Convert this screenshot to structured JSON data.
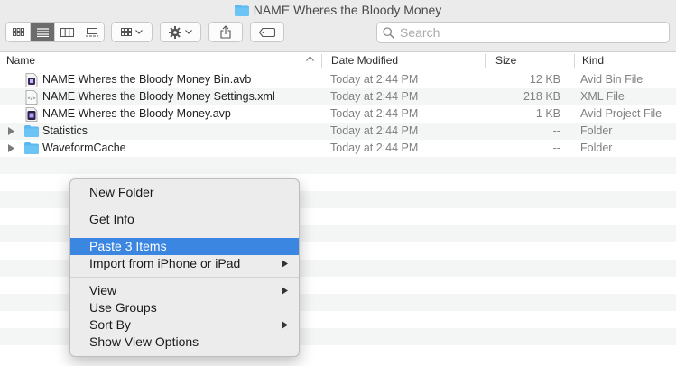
{
  "window": {
    "title": "NAME Wheres the Bloody Money"
  },
  "toolbar": {
    "view_modes": [
      {
        "name": "icon-view",
        "icon": "grid-icon",
        "active": false
      },
      {
        "name": "list-view",
        "icon": "list-icon",
        "active": true
      },
      {
        "name": "column-view",
        "icon": "columns-icon",
        "active": false
      },
      {
        "name": "gallery-view",
        "icon": "gallery-icon",
        "active": false
      }
    ],
    "search_placeholder": "Search"
  },
  "columns": {
    "name": "Name",
    "date": "Date Modified",
    "size": "Size",
    "kind": "Kind"
  },
  "files": [
    {
      "name": "NAME Wheres the Bloody Money Bin.avb",
      "date": "Today at 2:44 PM",
      "size": "12 KB",
      "kind": "Avid Bin File",
      "icon": "avid-bin-icon"
    },
    {
      "name": "NAME Wheres the Bloody Money Settings.xml",
      "date": "Today at 2:44 PM",
      "size": "218 KB",
      "kind": "XML File",
      "icon": "xml-file-icon"
    },
    {
      "name": "NAME Wheres the Bloody Money.avp",
      "date": "Today at 2:44 PM",
      "size": "1 KB",
      "kind": "Avid Project File",
      "icon": "avid-project-icon"
    },
    {
      "name": "Statistics",
      "date": "Today at 2:44 PM",
      "size": "--",
      "kind": "Folder",
      "icon": "folder-icon"
    },
    {
      "name": "WaveformCache",
      "date": "Today at 2:44 PM",
      "size": "--",
      "kind": "Folder",
      "icon": "folder-icon"
    }
  ],
  "context_menu": {
    "new_folder": "New Folder",
    "get_info": "Get Info",
    "paste": "Paste 3 Items",
    "import": "Import from iPhone or iPad",
    "view": "View",
    "use_groups": "Use Groups",
    "sort_by": "Sort By",
    "show_view_options": "Show View Options"
  },
  "colors": {
    "highlight": "#3b86e0",
    "folder": "#5bb8f0",
    "active_segment": "#6c6c6c"
  }
}
